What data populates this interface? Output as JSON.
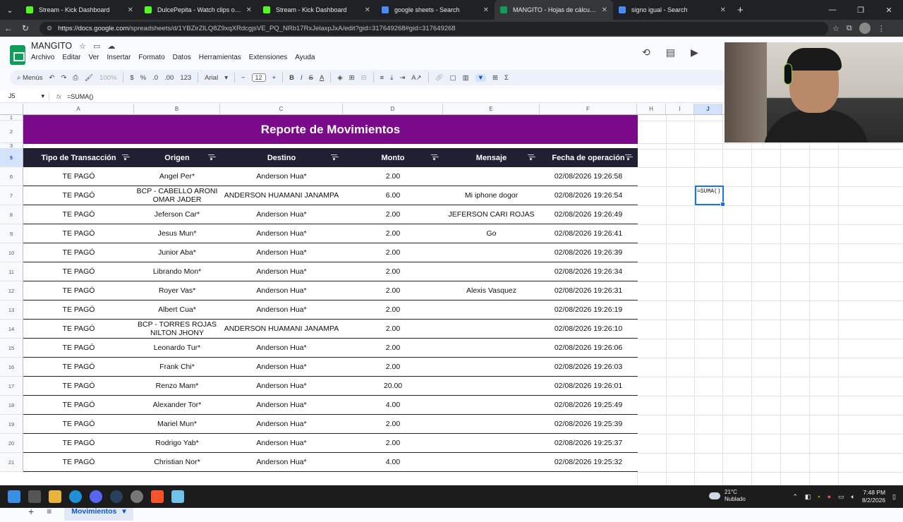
{
  "browser": {
    "tabs": [
      {
        "title": "Stream - Kick Dashboard",
        "active": false,
        "fav_color": "#53fc18"
      },
      {
        "title": "DulcePepita - Watch clips on Kick",
        "active": false,
        "fav_color": "#53fc18"
      },
      {
        "title": "Stream - Kick Dashboard",
        "active": false,
        "fav_color": "#53fc18"
      },
      {
        "title": "google sheets - Search",
        "active": false,
        "fav_color": "#4c8bf5"
      },
      {
        "title": "MANGITO - Hojas de cálculo de G",
        "active": true,
        "fav_color": "#0f9d58"
      },
      {
        "title": "signo igual - Search",
        "active": false,
        "fav_color": "#4c8bf5"
      }
    ],
    "url_host": "https://docs.google.com",
    "url_path": "/spreadsheets/d/1YBZirZlLQ8Z9xqXRdcgjsVE_PQ_NRb17RxJelaxpJxA/edit?gid=317649268#gid=317649268"
  },
  "doc": {
    "title": "MANGITO",
    "menus": [
      "Archivo",
      "Editar",
      "Ver",
      "Insertar",
      "Formato",
      "Datos",
      "Herramientas",
      "Extensiones",
      "Ayuda"
    ]
  },
  "toolbar": {
    "search": "Menús",
    "zoom": "100%",
    "currency": "$",
    "percent": "%",
    "dec_less": ".0",
    "dec_more": ".00",
    "fmt_123": "123",
    "font": "Arial",
    "font_size": "12"
  },
  "formula_bar": {
    "cell_ref": "J5",
    "formula": "=SUMA()"
  },
  "columns": [
    "A",
    "B",
    "C",
    "D",
    "E",
    "F",
    "H",
    "I",
    "J"
  ],
  "row_numbers": [
    "1",
    "2",
    "3",
    "5",
    "6",
    "7",
    "8",
    "9",
    "10",
    "11",
    "12",
    "13",
    "14",
    "15",
    "16",
    "17",
    "18",
    "19",
    "20",
    "21"
  ],
  "report": {
    "title": "Reporte de Movimientos",
    "headers": [
      "Tipo de Transacción",
      "Origen",
      "Destino",
      "Monto",
      "Mensaje",
      "Fecha de operación"
    ],
    "rows": [
      [
        "TE PAGÓ",
        "Angel Per*",
        "Anderson Hua*",
        "2.00",
        "",
        "02/08/2026 19:26:58"
      ],
      [
        "TE PAGÓ",
        "BCP - CABELLO ARONI OMAR JADER",
        "ANDERSON HUAMANI JANAMPA",
        "6.00",
        "Mi iphone dogor",
        "02/08/2026 19:26:54"
      ],
      [
        "TE PAGÓ",
        "Jeferson Car*",
        "Anderson Hua*",
        "2.00",
        "JEFERSON CARI ROJAS",
        "02/08/2026 19:26:49"
      ],
      [
        "TE PAGÓ",
        "Jesus Mun*",
        "Anderson Hua*",
        "2.00",
        "Go",
        "02/08/2026 19:26:41"
      ],
      [
        "TE PAGÓ",
        "Junior Aba*",
        "Anderson Hua*",
        "2.00",
        "",
        "02/08/2026 19:26:39"
      ],
      [
        "TE PAGÓ",
        "Librando Mon*",
        "Anderson Hua*",
        "2.00",
        "",
        "02/08/2026 19:26:34"
      ],
      [
        "TE PAGÓ",
        "Royer Vas*",
        "Anderson Hua*",
        "2.00",
        "Alexis Vasquez",
        "02/08/2026 19:26:31"
      ],
      [
        "TE PAGÓ",
        "Albert Cua*",
        "Anderson Hua*",
        "2.00",
        "",
        "02/08/2026 19:26:19"
      ],
      [
        "TE PAGÓ",
        "BCP - TORRES ROJAS NILTON JHONY",
        "ANDERSON HUAMANI JANAMPA",
        "2.00",
        "",
        "02/08/2026 19:26:10"
      ],
      [
        "TE PAGÓ",
        "Leonardo Tur*",
        "Anderson Hua*",
        "2.00",
        "",
        "02/08/2026 19:26:06"
      ],
      [
        "TE PAGÓ",
        "Frank Chi*",
        "Anderson Hua*",
        "2.00",
        "",
        "02/08/2026 19:26:03"
      ],
      [
        "TE PAGÓ",
        "Renzo Mam*",
        "Anderson Hua*",
        "20.00",
        "",
        "02/08/2026 19:26:01"
      ],
      [
        "TE PAGÓ",
        "Alexander Tor*",
        "Anderson Hua*",
        "4.00",
        "",
        "02/08/2026 19:25:49"
      ],
      [
        "TE PAGÓ",
        "Mariel Mun*",
        "Anderson Hua*",
        "2.00",
        "",
        "02/08/2026 19:25:39"
      ],
      [
        "TE PAGÓ",
        "Rodrigo Yab*",
        "Anderson Hua*",
        "2.00",
        "",
        "02/08/2026 19:25:37"
      ],
      [
        "TE PAGÓ",
        "Christian Nor*",
        "Anderson Hua*",
        "4.00",
        "",
        "02/08/2026 19:25:32"
      ]
    ]
  },
  "active_cell": {
    "ref": "J5",
    "value": "=SUMA()"
  },
  "sheet_tabs": [
    {
      "label": "Movimientos",
      "active": true
    }
  ],
  "taskbar": {
    "weather_temp": "21°C",
    "weather_desc": "Nublado",
    "time": "7:48 PM",
    "date": "8/2/2026"
  }
}
